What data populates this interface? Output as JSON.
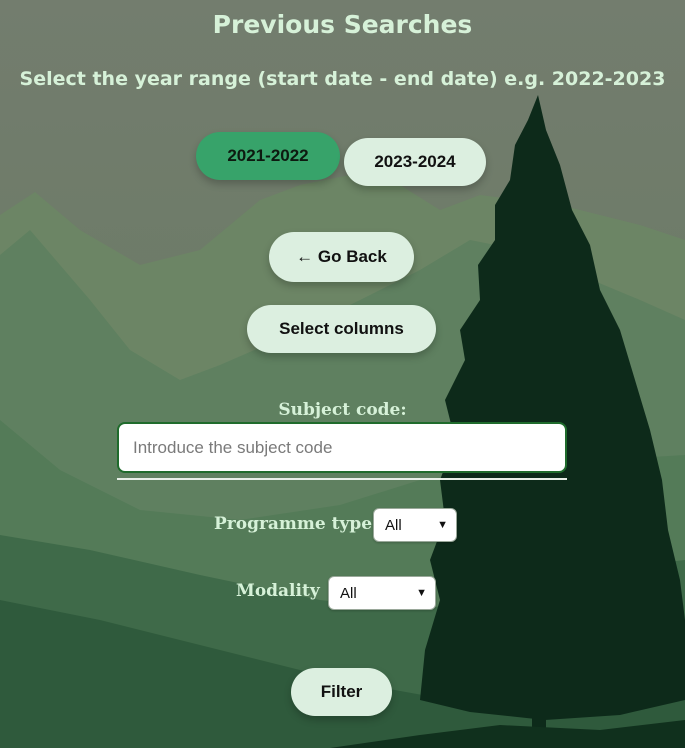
{
  "page": {
    "title": "Previous Searches",
    "subtitle": "Select the year range (start date - end date) e.g. 2022-2023"
  },
  "year_buttons": [
    {
      "label": "2021-2022",
      "active": true
    },
    {
      "label": "2023-2024",
      "active": false
    }
  ],
  "actions": {
    "go_back": "← Go Back",
    "select_columns": "Select columns",
    "filter": "Filter"
  },
  "subject_code": {
    "label": "Subject code:",
    "placeholder": "Introduce the subject code",
    "value": ""
  },
  "programme_type": {
    "label": "Programme type",
    "selected": "All"
  },
  "modality": {
    "label": "Modality",
    "selected": "All"
  },
  "colors": {
    "heading_text": "#d6f1d8",
    "active_button": "#37a36a",
    "button": "#dcefe0",
    "input_border": "#1f6b2c",
    "tree": "#0d2a1a"
  }
}
